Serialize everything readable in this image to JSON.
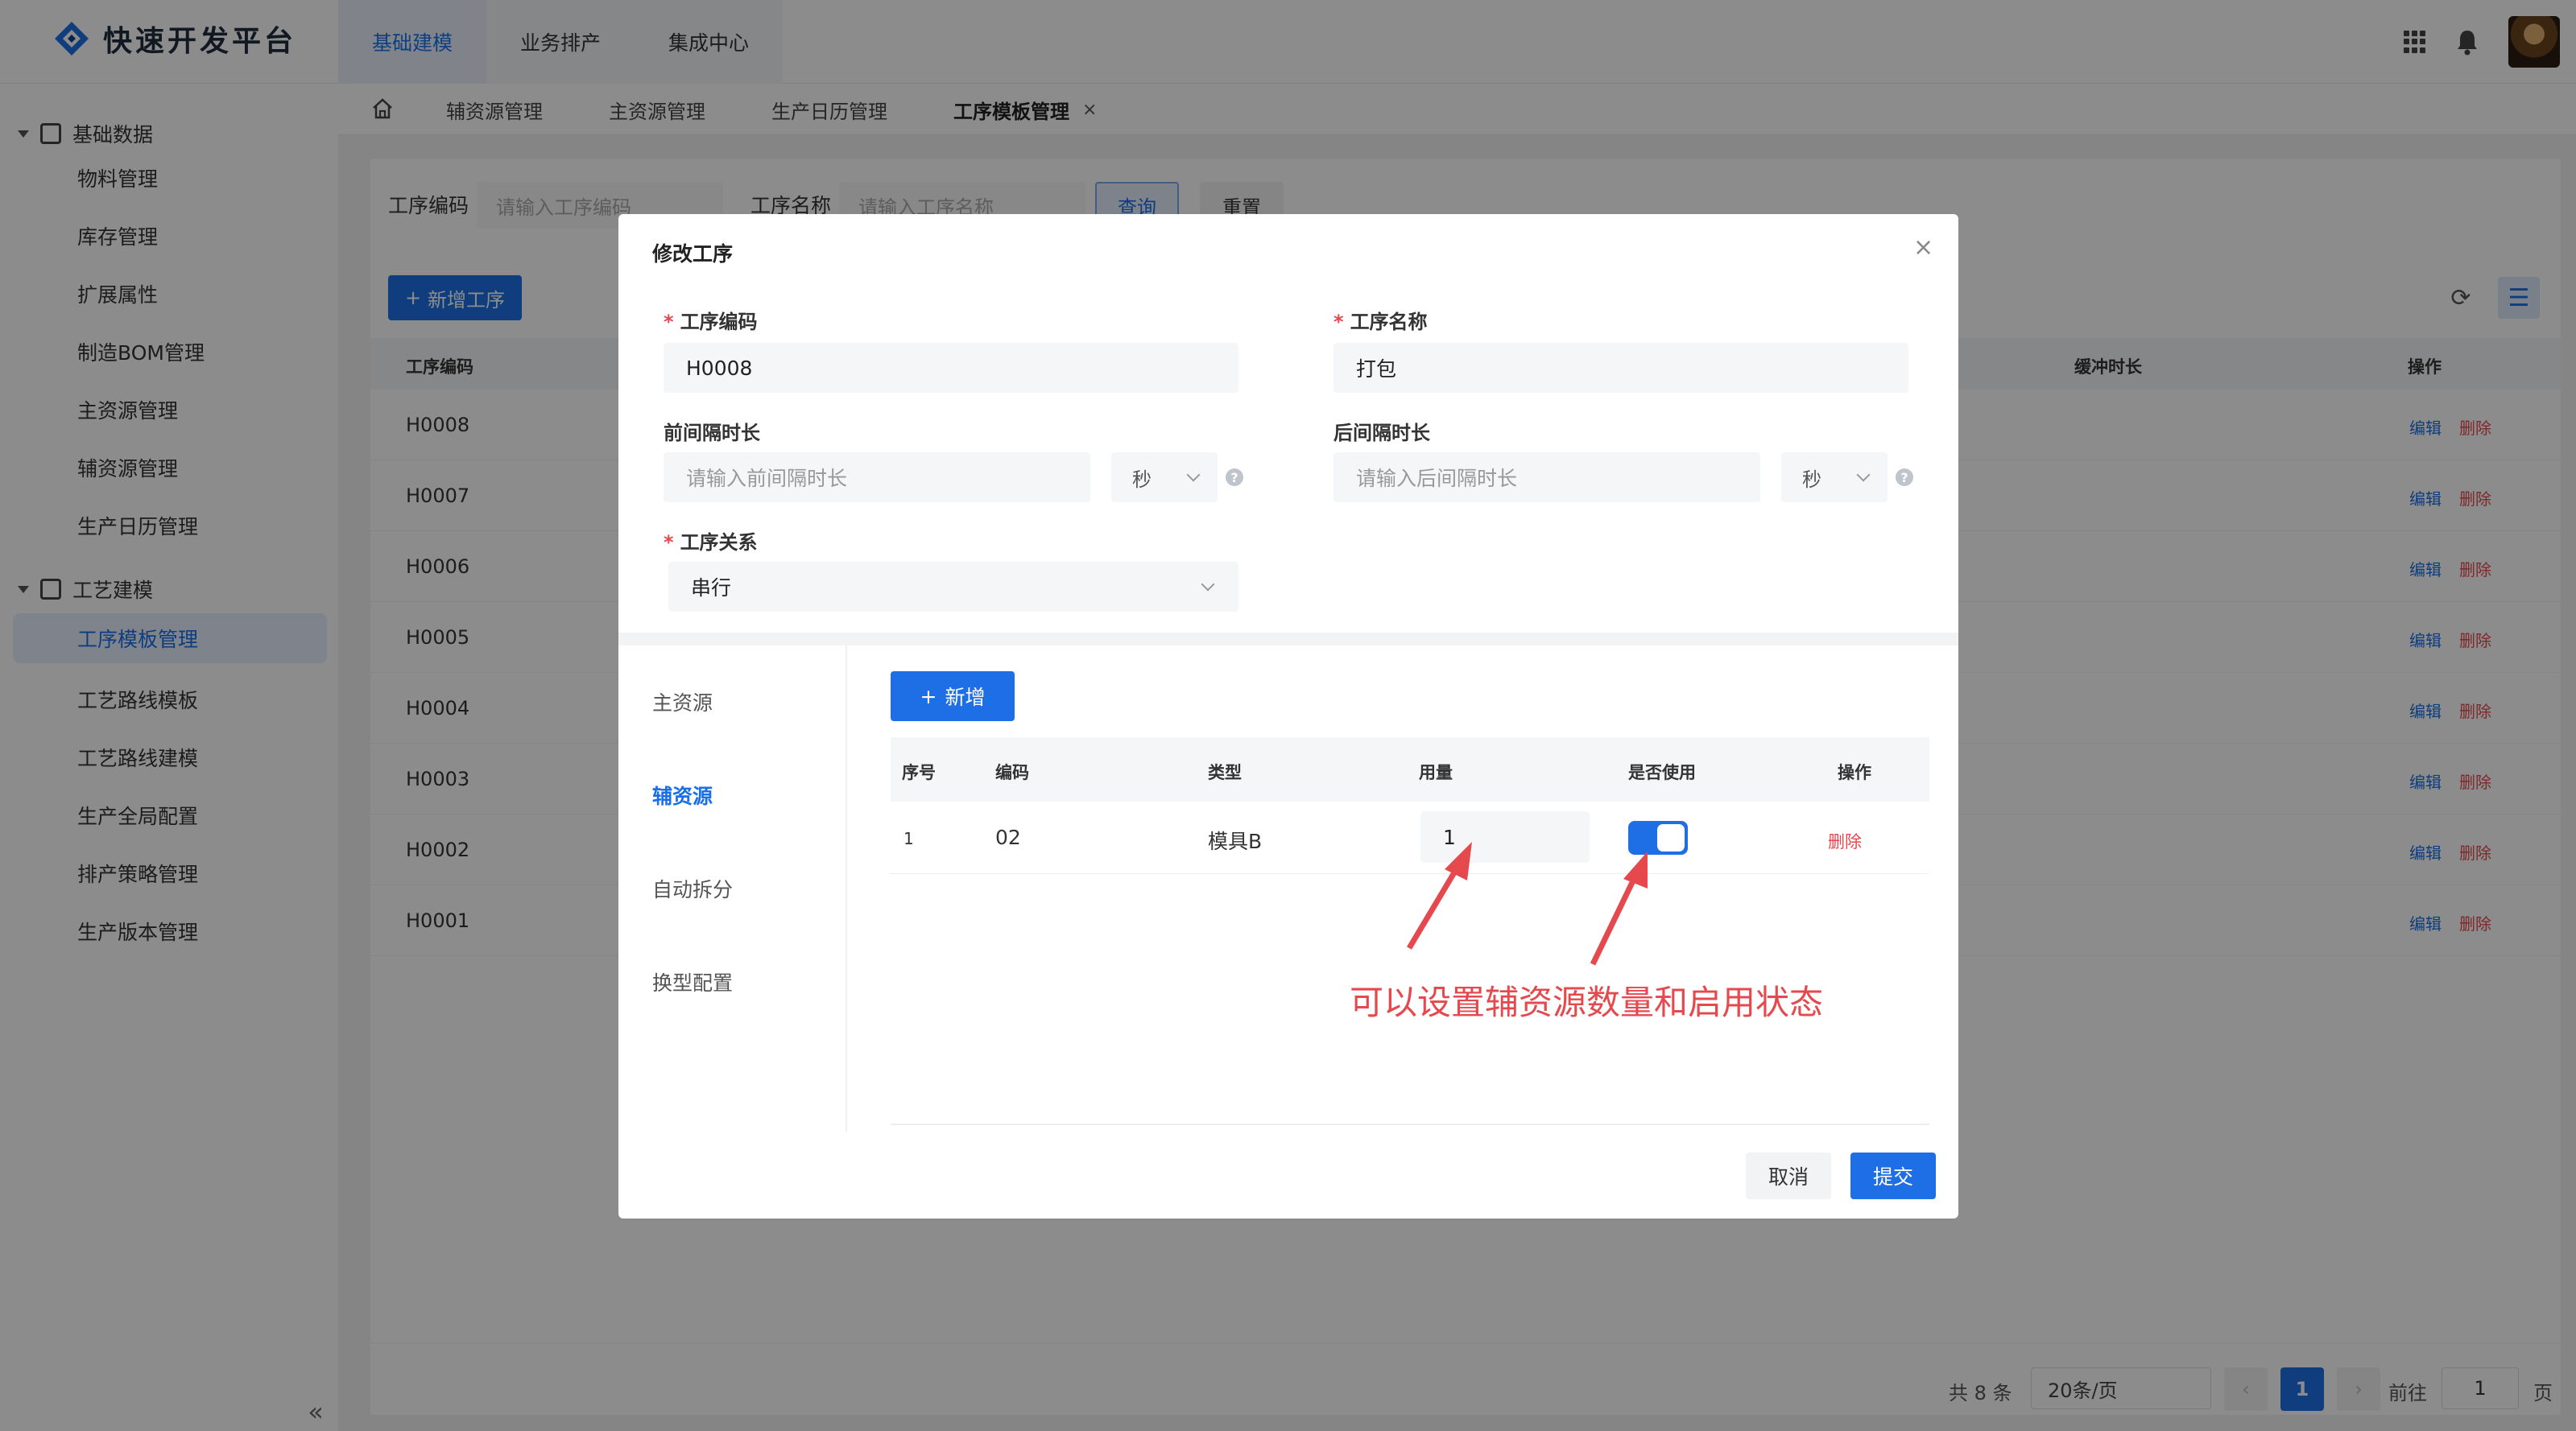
{
  "app": {
    "title": "快速开发平台"
  },
  "topnav": [
    {
      "label": "基础建模",
      "active": true
    },
    {
      "label": "业务排产",
      "active": false
    },
    {
      "label": "集成中心",
      "active": false
    }
  ],
  "header_icons": [
    "apps-grid-icon",
    "bell-icon",
    "user-avatar"
  ],
  "sidebar": {
    "groups": [
      {
        "label": "基础数据",
        "icon": "chart-icon",
        "items": [
          "物料管理",
          "库存管理",
          "扩展属性",
          "制造BOM管理",
          "主资源管理",
          "辅资源管理",
          "生产日历管理"
        ]
      },
      {
        "label": "工艺建模",
        "icon": "process-icon",
        "items": [
          "工序模板管理",
          "工艺路线模板",
          "工艺路线建模",
          "生产全局配置",
          "排产策略管理",
          "生产版本管理"
        ]
      }
    ],
    "active_item": "工序模板管理",
    "collapse": "«"
  },
  "tabs": {
    "items": [
      "辅资源管理",
      "主资源管理",
      "生产日历管理",
      "工序模板管理"
    ],
    "active": "工序模板管理",
    "close": "×"
  },
  "query": {
    "code_label": "工序编码",
    "code_placeholder": "请输入工序编码",
    "name_label": "工序名称",
    "name_placeholder": "请输入工序名称",
    "search_btn": "查询",
    "reset_btn": "重置"
  },
  "toolbar": {
    "add_label": "新增工序"
  },
  "table": {
    "headers": {
      "code": "工序编码",
      "buffer": "缓冲时长",
      "ops": "操作"
    },
    "rows": [
      "H0008",
      "H0007",
      "H0006",
      "H0005",
      "H0004",
      "H0003",
      "H0002",
      "H0001"
    ],
    "edit": "编辑",
    "delete": "删除"
  },
  "pagination": {
    "total": "共 8 条",
    "page_size": "20条/页",
    "prev": "‹",
    "current": "1",
    "next": "›",
    "goto_label": "前往",
    "goto_value": "1",
    "unit": "页"
  },
  "dialog": {
    "title": "修改工序",
    "close": "×",
    "fields": {
      "code_label": "工序编码",
      "code_value": "H0008",
      "name_label": "工序名称",
      "name_value": "打包",
      "pre_label": "前间隔时长",
      "pre_placeholder": "请输入前间隔时长",
      "pre_unit": "秒",
      "post_label": "后间隔时长",
      "post_placeholder": "请输入后间隔时长",
      "post_unit": "秒",
      "relation_label": "工序关系",
      "relation_value": "串行",
      "help": "?"
    },
    "side_tabs": [
      "主资源",
      "辅资源",
      "自动拆分",
      "换型配置"
    ],
    "active_side_tab": "辅资源",
    "sub_add": "新增",
    "sub_table": {
      "headers": [
        "序号",
        "编码",
        "类型",
        "用量",
        "是否使用",
        "操作"
      ],
      "row": {
        "index": "1",
        "code": "02",
        "type": "模具B",
        "qty": "1",
        "enabled": true,
        "delete": "删除"
      }
    },
    "cancel": "取消",
    "submit": "提交"
  },
  "annotation": {
    "text": "可以设置辅资源数量和启用状态",
    "color": "#e5484d"
  },
  "colors": {
    "primary": "#1e6fe6",
    "danger": "#e5484d"
  }
}
